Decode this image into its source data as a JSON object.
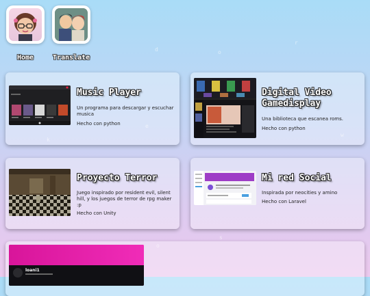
{
  "nav": [
    {
      "label": "Home"
    },
    {
      "label": "Translate"
    }
  ],
  "projects": [
    {
      "title": "Music Player",
      "description": "Un programa para descargar y escuchar musica",
      "tech": "Hecho con python"
    },
    {
      "title": "Digital Video Gamedisplay",
      "description": "Una biblioteca que escanea roms.",
      "tech": "Hecho con python"
    },
    {
      "title": "Proyecto Terror",
      "description": "Juego inspirado por resident evil, silent hill, y los juegos de terror de rpg maker :p",
      "tech": "Hecho con Unity"
    },
    {
      "title": "Mi red Social",
      "description": "Inspirada por neocities y amino",
      "tech": "Hecho con Laravel"
    },
    {
      "title": "",
      "description": "",
      "tech": ""
    }
  ],
  "thumb_text": {
    "social_username": "loani1"
  },
  "colors": {
    "bg_top": "#a9dcf7",
    "bg_bottom": "#ecc9ee",
    "social_pink": "#e01ea8",
    "social_purple": "#7b4fd6"
  }
}
